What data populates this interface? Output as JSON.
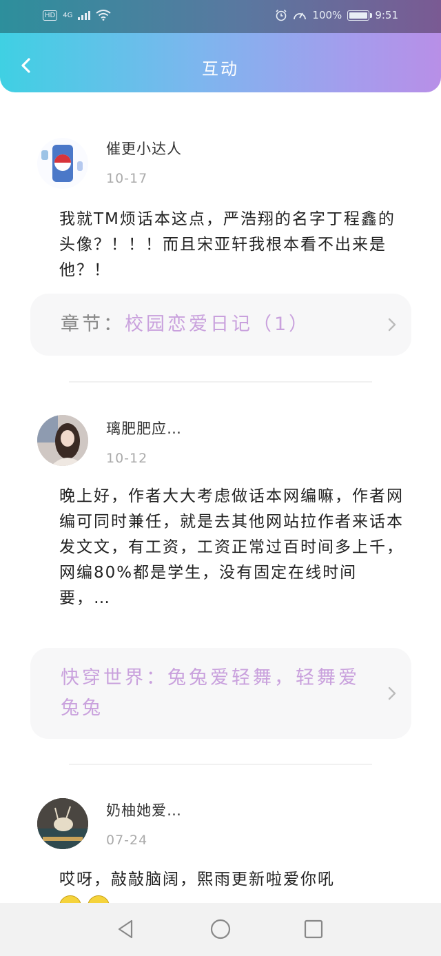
{
  "statusbar": {
    "network": "4G",
    "hd": "HD",
    "battery_percent": "100%",
    "time": "9:51"
  },
  "header": {
    "title": "互动",
    "back_icon": "chevron-left-icon"
  },
  "comments": [
    {
      "username": "催更小达人",
      "date": "10-17",
      "text": "我就TM烦话本这点，严浩翔的名字丁程鑫的头像？！！！而且宋亚轩我根本看不出来是他？！",
      "chapter_label": "章节：",
      "chapter_title": "校园恋爱日记（1）"
    },
    {
      "username": "璃肥肥应…",
      "date": "10-12",
      "text": "晚上好，作者大大考虑做话本网编嘛，作者网编可同时兼任，就是去其他网站拉作者来话本发文文，有工资，工资正常过百时间多上千，网编80%都是学生，没有固定在线时间要，…",
      "chapter_title": "快穿世界：兔兔爱轻舞，轻舞爱兔兔"
    },
    {
      "username": "奶柚她爱…",
      "date": "07-24",
      "text": "哎呀，敲敲脑阔，熙雨更新啦爱你吼"
    }
  ],
  "colors": {
    "header_gradient_start": "#3fd0e3",
    "header_gradient_end": "#b88fe7",
    "chapter_link": "#c9a1dd",
    "date_text": "#aaaaaa"
  }
}
